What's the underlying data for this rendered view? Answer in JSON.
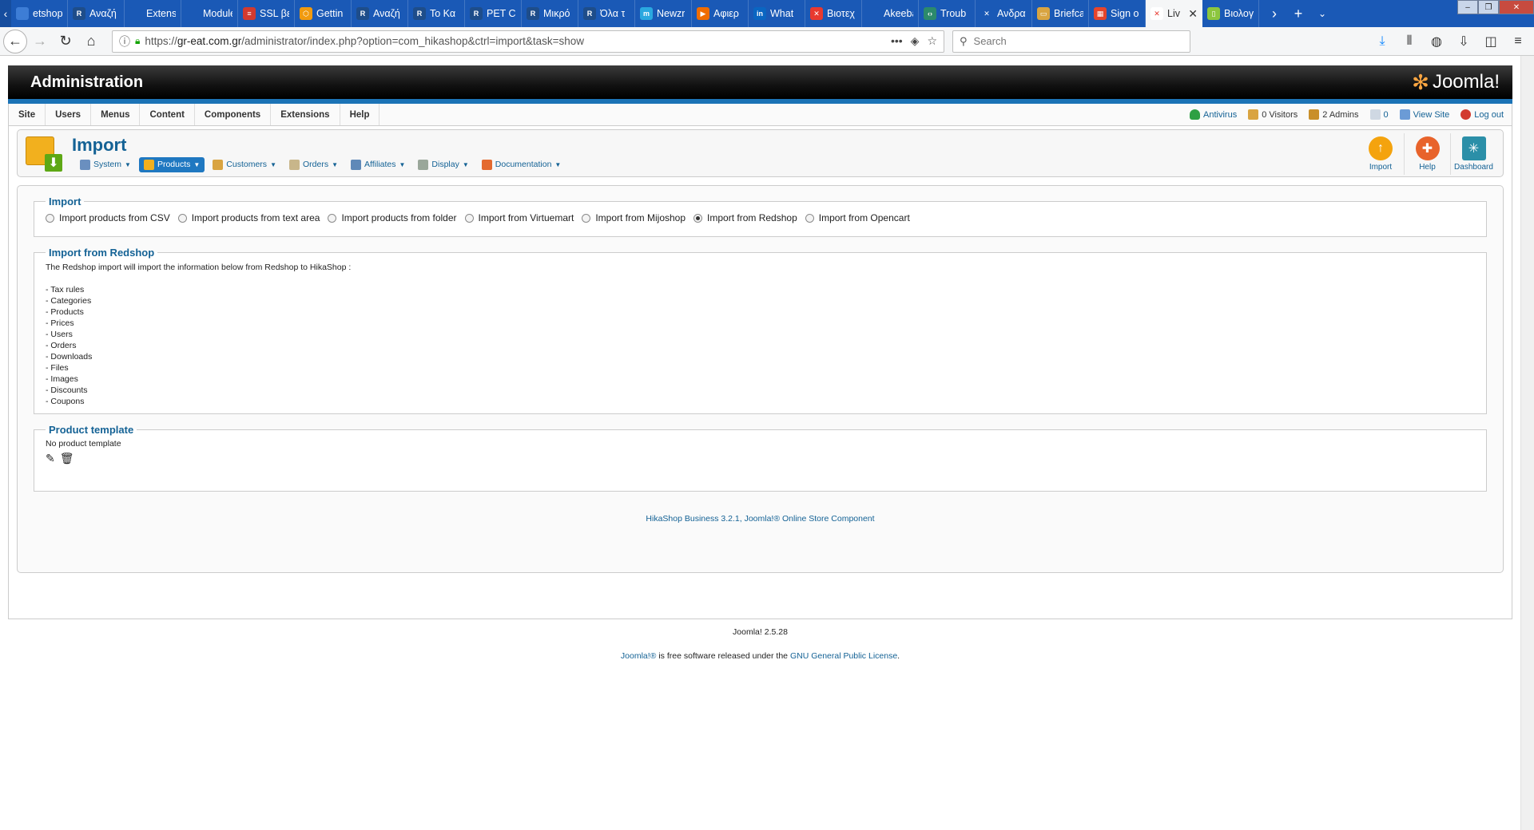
{
  "browser": {
    "tabs": [
      {
        "label": "etshop.gr",
        "fav_color": "#3d7dd6",
        "fav": ""
      },
      {
        "label": "Αναζή",
        "fav_color": "#1e4d8a",
        "fav": "R"
      },
      {
        "label": "Extensions",
        "fav_color": "#1a59b6",
        "fav": ""
      },
      {
        "label": "Modules (",
        "fav_color": "#1a59b6",
        "fav": ""
      },
      {
        "label": "SSL βε",
        "fav_color": "#d23a2f",
        "fav": "≡"
      },
      {
        "label": "Gettin",
        "fav_color": "#f19a0e",
        "fav": "⬡"
      },
      {
        "label": "Αναζή",
        "fav_color": "#1e4d8a",
        "fav": "R"
      },
      {
        "label": "Το Κα",
        "fav_color": "#1e4d8a",
        "fav": "R"
      },
      {
        "label": "PET C",
        "fav_color": "#1e4d8a",
        "fav": "R"
      },
      {
        "label": "Μικρό",
        "fav_color": "#1e4d8a",
        "fav": "R"
      },
      {
        "label": "Όλα τ",
        "fav_color": "#1e4d8a",
        "fav": "R"
      },
      {
        "label": "Newzr",
        "fav_color": "#2aa8e0",
        "fav": "m"
      },
      {
        "label": "Αφιερ",
        "fav_color": "#ef6c00",
        "fav": "▶"
      },
      {
        "label": "What",
        "fav_color": "#0a66c2",
        "fav": "in"
      },
      {
        "label": "Βιοτεχ",
        "fav_color": "#e8392f",
        "fav": "✕"
      },
      {
        "label": "Akeeba Ki",
        "fav_color": "#1a59b6",
        "fav": ""
      },
      {
        "label": "Troub",
        "fav_color": "#2c8a6c",
        "fav": "‹›"
      },
      {
        "label": "Ανδρα",
        "fav_color": "#1a59b6",
        "fav": "✕"
      },
      {
        "label": "Briefca",
        "fav_color": "#d9a441",
        "fav": "▭"
      },
      {
        "label": "Sign o",
        "fav_color": "#e6452c",
        "fav": "▦"
      },
      {
        "label": "Liv",
        "fav_color": "#ffffff",
        "fav": "✕",
        "active": true
      },
      {
        "label": "Βιολογ",
        "fav_color": "#8cc63e",
        "fav": "▯"
      }
    ],
    "url_prefix": "https://",
    "url_domain": "gr-eat.com.gr",
    "url_rest": "/administrator/index.php?option=com_hikashop&ctrl=import&task=show",
    "search_placeholder": "Search"
  },
  "admin": {
    "title": "Administration",
    "logo_text": "Joomla!",
    "menu": [
      "Site",
      "Users",
      "Menus",
      "Content",
      "Components",
      "Extensions",
      "Help"
    ],
    "status": {
      "antivirus": "Antivirus",
      "visitors": "0 Visitors",
      "admins": "2 Admins",
      "messages": "0",
      "view_site": "View Site",
      "logout": "Log out"
    }
  },
  "toolbar": {
    "title": "Import",
    "submenu": [
      {
        "label": "System",
        "color": "#6a8fbf"
      },
      {
        "label": "Products",
        "color": "#f2b01e",
        "active": true
      },
      {
        "label": "Customers",
        "color": "#d9a441"
      },
      {
        "label": "Orders",
        "color": "#c8b68a"
      },
      {
        "label": "Affiliates",
        "color": "#5f89b8"
      },
      {
        "label": "Display",
        "color": "#9aa79a"
      },
      {
        "label": "Documentation",
        "color": "#e46a2f"
      }
    ],
    "actions": {
      "import": "Import",
      "help": "Help",
      "dashboard": "Dashboard"
    }
  },
  "import": {
    "legend": "Import",
    "options": [
      {
        "label": "Import products from CSV",
        "checked": false
      },
      {
        "label": "Import products from text area",
        "checked": false
      },
      {
        "label": "Import products from folder",
        "checked": false
      },
      {
        "label": "Import from Virtuemart",
        "checked": false
      },
      {
        "label": "Import from Mijoshop",
        "checked": false
      },
      {
        "label": "Import from Redshop",
        "checked": true
      },
      {
        "label": "Import from Opencart",
        "checked": false
      }
    ]
  },
  "redshop": {
    "legend": "Import from Redshop",
    "intro": "The Redshop import will import the information below from Redshop to HikaShop :",
    "items": [
      "- Tax rules",
      "- Categories",
      "- Products",
      "- Prices",
      "- Users",
      "- Orders",
      "- Downloads",
      "- Files",
      "- Images",
      "- Discounts",
      "- Coupons"
    ]
  },
  "template": {
    "legend": "Product template",
    "text": "No product template"
  },
  "footer": {
    "hikashop": "HikaShop Business 3.2.1, Joomla!® Online Store Component",
    "version": "Joomla! 2.5.28",
    "license_pre": "Joomla!®",
    "license_mid": " is free software released under the ",
    "license_link": "GNU General Public License",
    "license_end": "."
  }
}
